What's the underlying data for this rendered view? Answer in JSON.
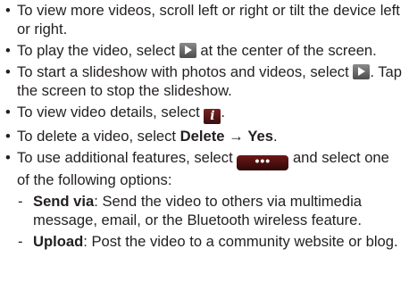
{
  "bullets": [
    {
      "text": "To view more videos, scroll left or right or tilt the device left or right."
    },
    {
      "pre": "To play the video, select",
      "icon": "play-icon",
      "post": "at the center of the screen."
    },
    {
      "pre": "To start a slideshow with photos and videos, select",
      "icon": "play-icon",
      "post": ". Tap the screen to stop the slideshow."
    },
    {
      "pre": "To view video details, select",
      "icon": "info-icon",
      "icon_glyph": "i",
      "post": "."
    },
    {
      "pre": "To delete a video, select",
      "bold1": "Delete",
      "arrow": "→",
      "bold2": "Yes",
      "post": "."
    },
    {
      "pre": "To use additional features, select",
      "icon": "more-options-icon",
      "icon_glyph": "•••",
      "post": "and select one of the following options:"
    }
  ],
  "options": [
    {
      "label": "Send via",
      "description": ": Send the video to others via multimedia message, email, or the Bluetooth wireless feature."
    },
    {
      "label": "Upload",
      "description": ": Post the video to a community website or blog."
    }
  ],
  "colors": {
    "text": "#231f20",
    "icon_dark_red": "#6d1717",
    "icon_gray": "#6a6a6a"
  }
}
